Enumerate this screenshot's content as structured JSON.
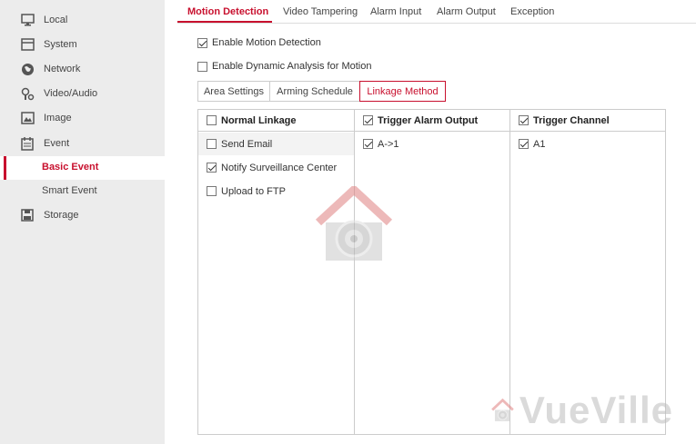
{
  "sidebar": {
    "items": [
      {
        "label": "Local",
        "icon": "monitor-icon"
      },
      {
        "label": "System",
        "icon": "system-icon"
      },
      {
        "label": "Network",
        "icon": "globe-icon"
      },
      {
        "label": "Video/Audio",
        "icon": "microphone-icon"
      },
      {
        "label": "Image",
        "icon": "image-icon"
      },
      {
        "label": "Event",
        "icon": "calendar-icon"
      }
    ],
    "sub_items": [
      {
        "label": "Basic Event",
        "active": true
      },
      {
        "label": "Smart Event",
        "active": false
      }
    ],
    "storage": {
      "label": "Storage",
      "icon": "save-icon"
    }
  },
  "top_tabs": [
    {
      "label": "Motion Detection",
      "active": true
    },
    {
      "label": "Video Tampering"
    },
    {
      "label": "Alarm Input"
    },
    {
      "label": "Alarm Output"
    },
    {
      "label": "Exception"
    }
  ],
  "options": {
    "enable_motion": {
      "label": "Enable Motion Detection",
      "checked": true
    },
    "enable_dynamic": {
      "label": "Enable Dynamic Analysis for Motion",
      "checked": false
    }
  },
  "sub_tabs": [
    {
      "label": "Area Settings"
    },
    {
      "label": "Arming Schedule"
    },
    {
      "label": "Linkage Method",
      "active": true
    }
  ],
  "linkage": {
    "normal": {
      "header": "Normal Linkage",
      "items": [
        {
          "label": "Send Email",
          "checked": false
        },
        {
          "label": "Notify Surveillance Center",
          "checked": true
        },
        {
          "label": "Upload to FTP",
          "checked": false
        }
      ]
    },
    "alarm_output": {
      "header": "Trigger Alarm Output",
      "items": [
        {
          "label": "A->1",
          "checked": true
        }
      ]
    },
    "channel": {
      "header": "Trigger Channel",
      "items": [
        {
          "label": "A1",
          "checked": true
        }
      ]
    }
  },
  "watermark": {
    "text": "VueVille"
  },
  "colors": {
    "accent": "#c8102e",
    "sidebar_bg": "#ececec"
  }
}
